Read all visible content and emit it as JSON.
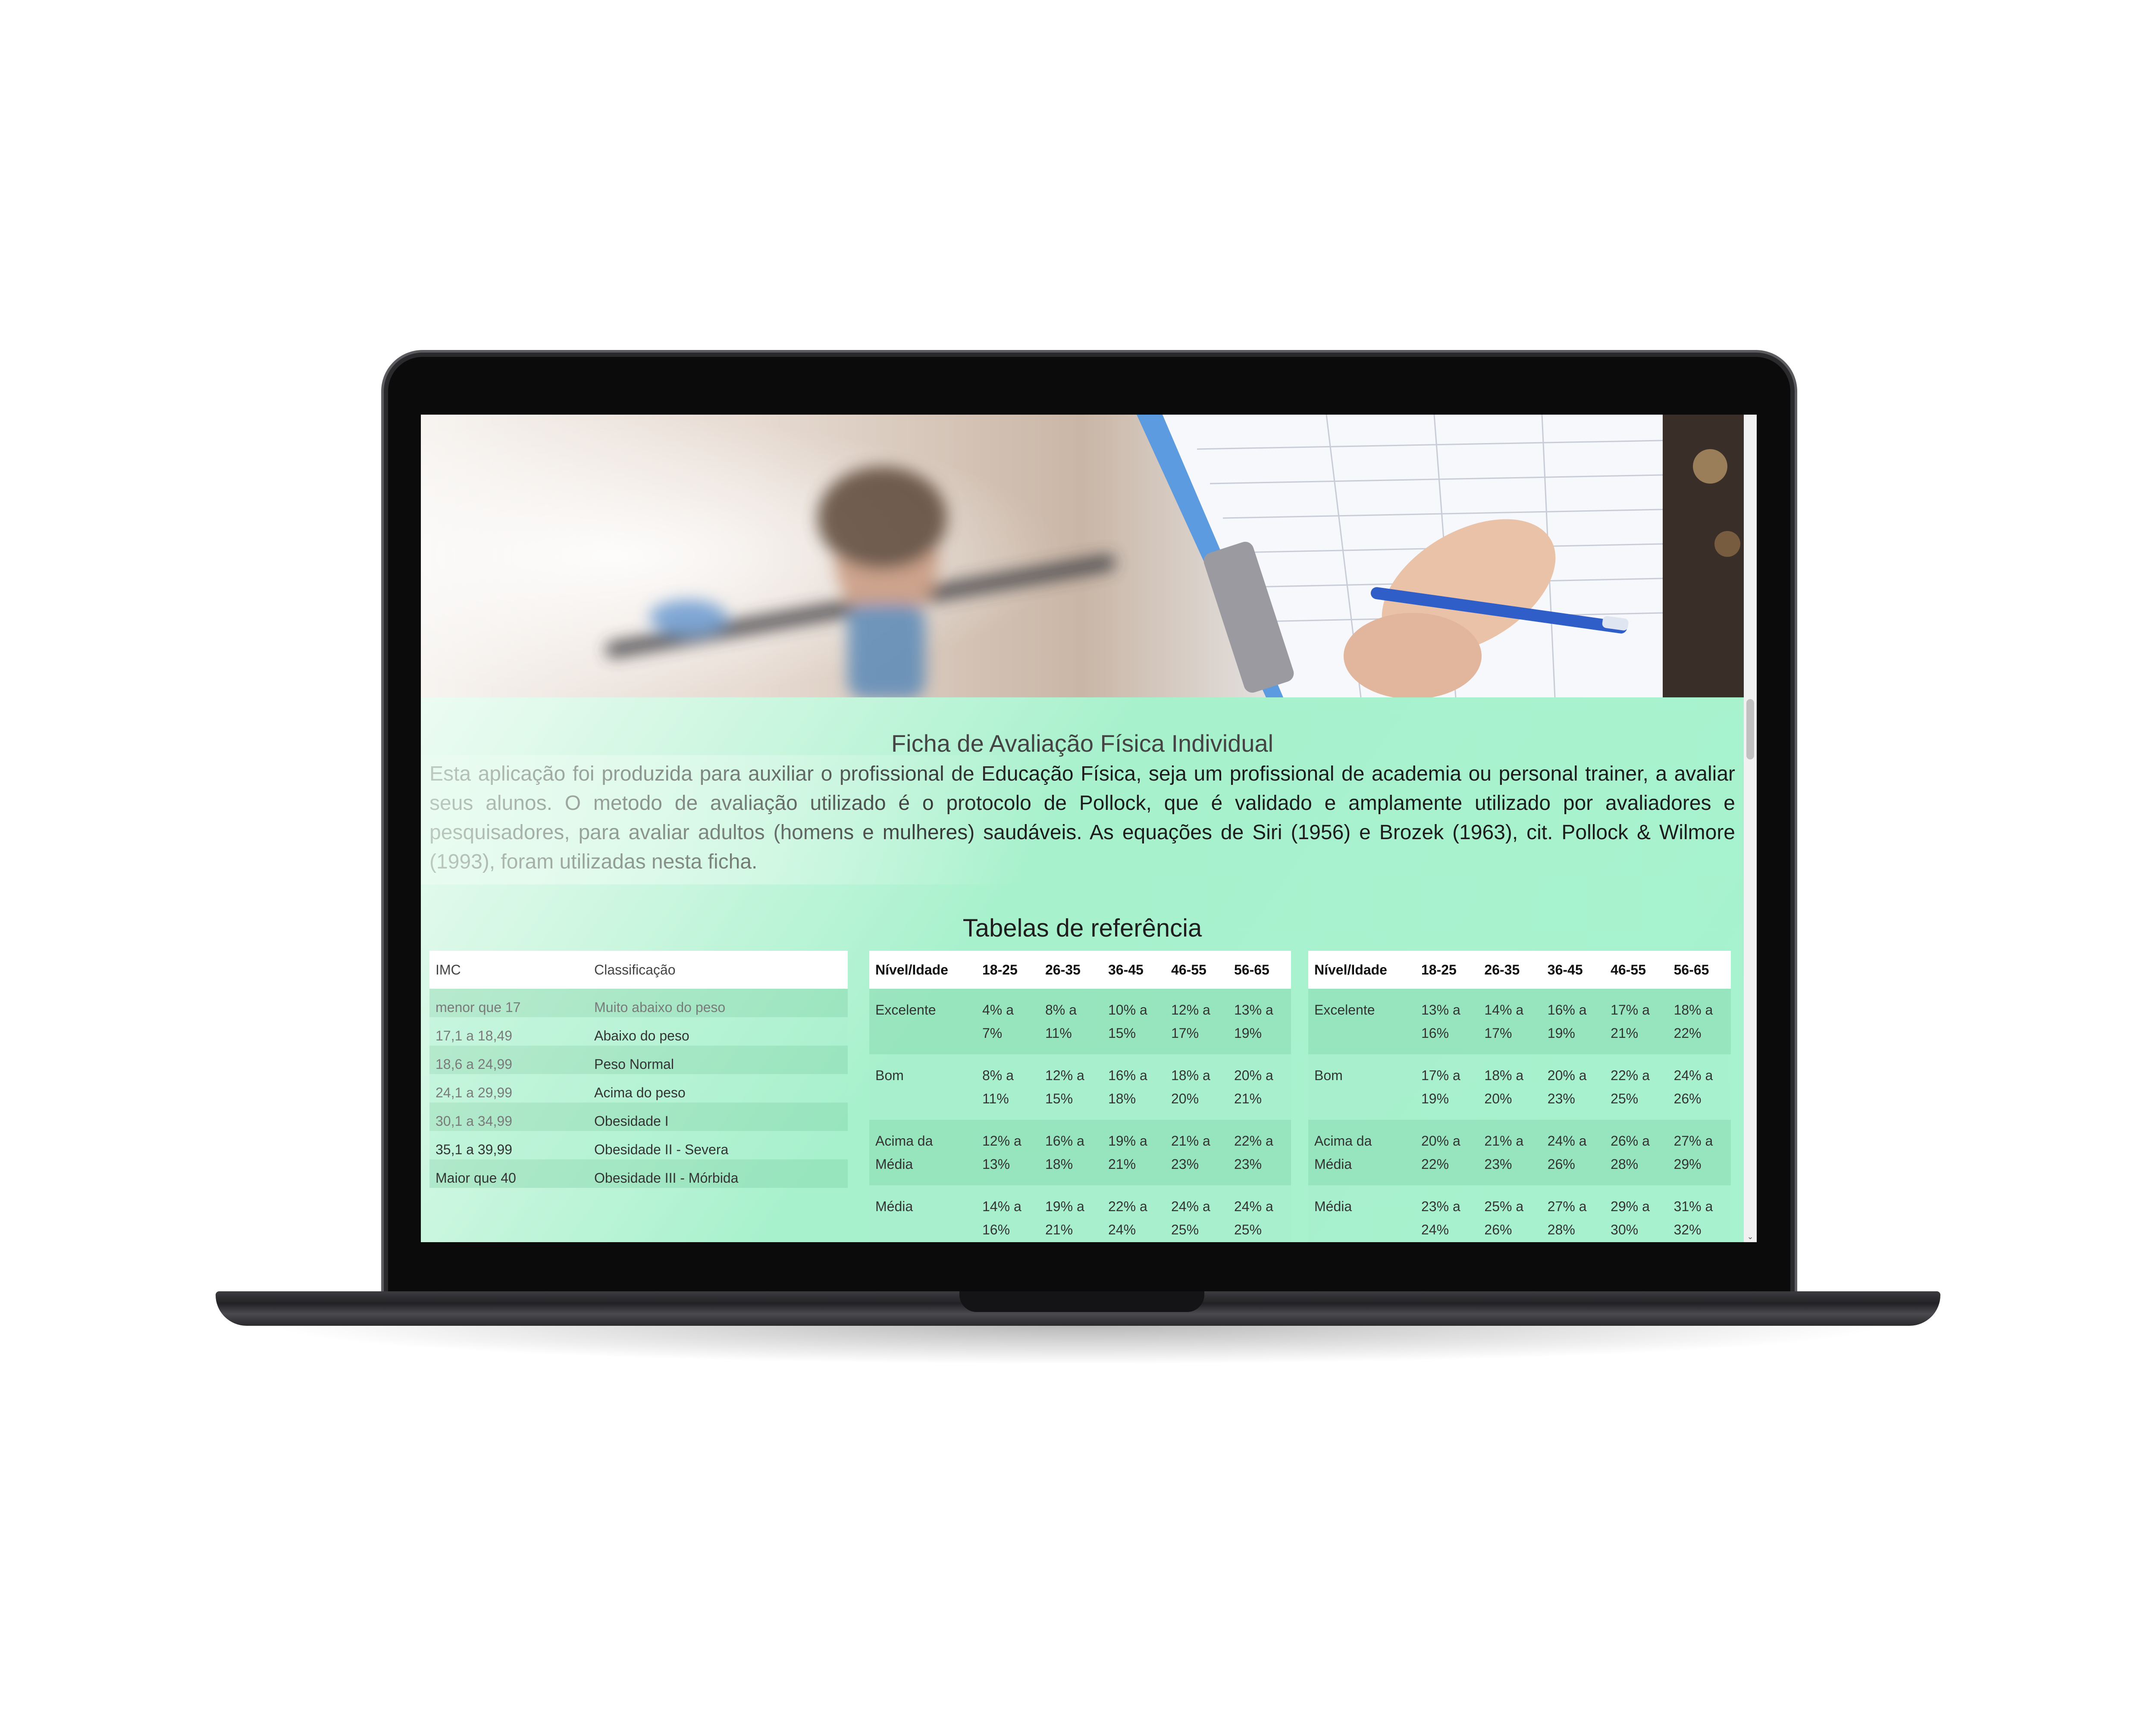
{
  "header": {
    "title": "Ficha de Avaliação Física Individual",
    "intro": "Esta aplicação foi produzida para auxiliar o profissional de Educação Física, seja um profissional de academia ou personal trainer, a avaliar seus alunos. O metodo de avaliação utilizado é o protocolo de Pollock, que é validado e amplamente utilizado por avaliadores e pesquisadores, para avaliar adultos (homens e mulheres) saudáveis. As equações de Siri (1956) e Brozek (1963), cit. Pollock & Wilmore (1993), foram utilizadas nesta ficha."
  },
  "reference": {
    "title": "Tabelas de referência",
    "imc_table": {
      "headers": [
        "IMC",
        "Classificação"
      ],
      "rows": [
        [
          "menor que 17",
          "Muito abaixo do peso"
        ],
        [
          "17,1 a 18,49",
          "Abaixo do peso"
        ],
        [
          "18,6 a 24,99",
          "Peso Normal"
        ],
        [
          "24,1 a 29,99",
          "Acima do peso"
        ],
        [
          "30,1 a 34,99",
          "Obesidade I"
        ],
        [
          "35,1 a 39,99",
          "Obesidade II - Severa"
        ],
        [
          "Maior que 40",
          "Obesidade III - Mórbida"
        ]
      ]
    },
    "table_a": {
      "headers": [
        "Nível/Idade",
        "18-25",
        "26-35",
        "36-45",
        "46-55",
        "56-65"
      ],
      "rows": [
        [
          "Excelente",
          "4% a 7%",
          "8% a 11%",
          "10% a 15%",
          "12% a 17%",
          "13% a 19%"
        ],
        [
          "Bom",
          "8% a 11%",
          "12% a 15%",
          "16% a 18%",
          "18% a 20%",
          "20% a 21%"
        ],
        [
          "Acima da Média",
          "12% a 13%",
          "16% a 18%",
          "19% a 21%",
          "21% a 23%",
          "22% a 23%"
        ],
        [
          "Média",
          "14% a 16%",
          "19% a 21%",
          "22% a 24%",
          "24% a 25%",
          "24% a 25%"
        ]
      ]
    },
    "table_b": {
      "headers": [
        "Nível/Idade",
        "18-25",
        "26-35",
        "36-45",
        "46-55",
        "56-65"
      ],
      "rows": [
        [
          "Excelente",
          "13% a 16%",
          "14% a 17%",
          "16% a 19%",
          "17% a 21%",
          "18% a 22%"
        ],
        [
          "Bom",
          "17% a 19%",
          "18% a 20%",
          "20% a 23%",
          "22% a 25%",
          "24% a 26%"
        ],
        [
          "Acima da Média",
          "20% a 22%",
          "21% a 23%",
          "24% a 26%",
          "26% a 28%",
          "27% a 29%"
        ],
        [
          "Média",
          "23% a 24%",
          "25% a 26%",
          "27% a 28%",
          "29% a 30%",
          "31% a 32%"
        ]
      ]
    }
  }
}
